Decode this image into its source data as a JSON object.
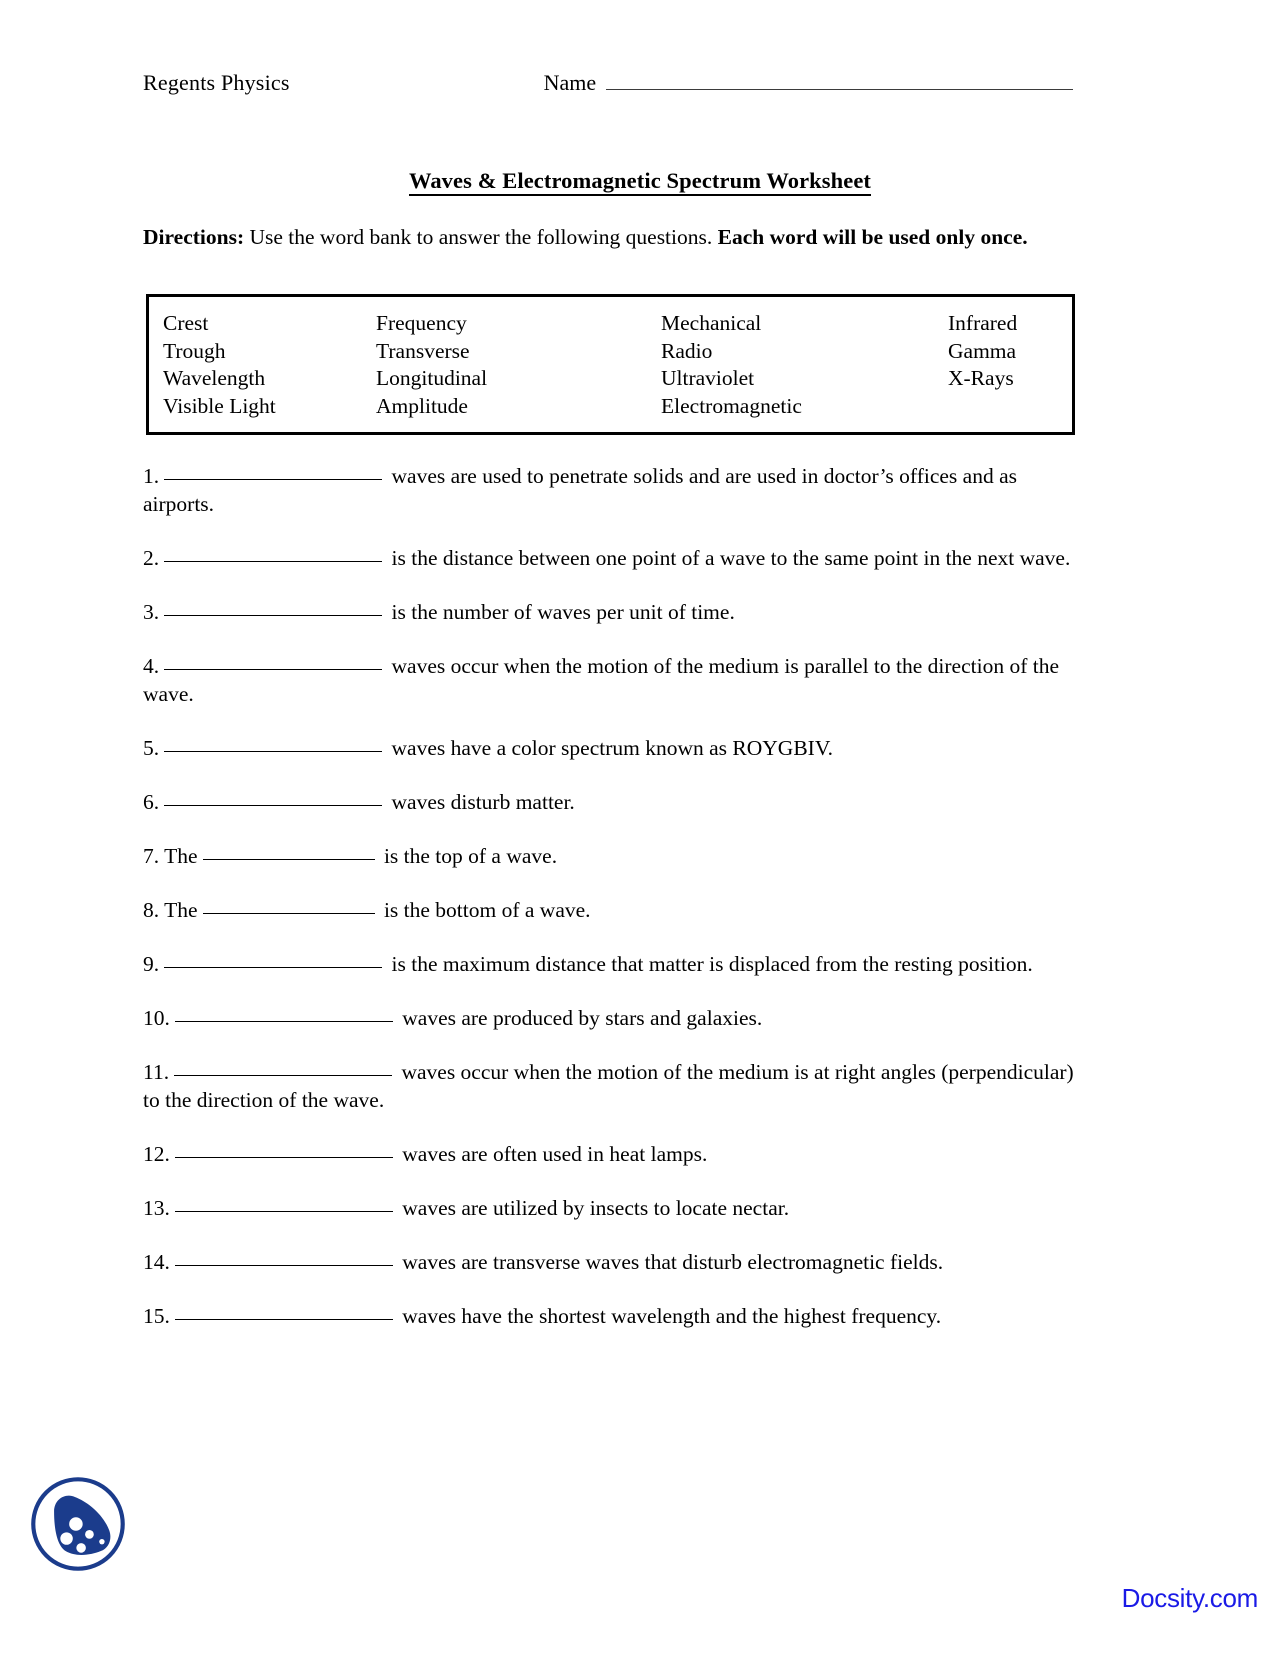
{
  "header": {
    "course": "Regents Physics",
    "name_label": "Name",
    "name_value": ""
  },
  "title": "Waves & Electromagnetic Spectrum Worksheet",
  "directions": {
    "label": "Directions:",
    "body": " Use the word bank to answer the following questions. ",
    "emphasis": "Each word will be used only once."
  },
  "word_bank": {
    "columns": [
      [
        "Crest",
        "Trough",
        "Wavelength",
        "Visible Light"
      ],
      [
        "Frequency",
        "Transverse",
        "Longitudinal",
        "Amplitude"
      ],
      [
        "Mechanical",
        "Radio",
        "Ultraviolet",
        "Electromagnetic"
      ],
      [
        "Infrared",
        "Gamma",
        "X-Rays"
      ]
    ]
  },
  "questions": [
    {
      "number": "1.",
      "pre": "",
      "blank": "long",
      "post": " waves are used to penetrate solids and are used in doctor’s offices and as airports."
    },
    {
      "number": "2.",
      "pre": "",
      "blank": "long",
      "post": " is the distance between one point of a wave to the same point in the next wave."
    },
    {
      "number": "3.",
      "pre": "",
      "blank": "long",
      "post": " is the number of waves per unit of time."
    },
    {
      "number": "4.",
      "pre": "",
      "blank": "long",
      "post": " waves occur when the motion of the medium is parallel to the direction of the wave."
    },
    {
      "number": "5.",
      "pre": "",
      "blank": "long",
      "post": " waves have a color spectrum known as ROYGBIV."
    },
    {
      "number": "6.",
      "pre": "",
      "blank": "long",
      "post": " waves disturb matter."
    },
    {
      "number": "7.",
      "pre": "The",
      "blank": "short",
      "post": " is the top of a wave."
    },
    {
      "number": "8.",
      "pre": "The",
      "blank": "short",
      "post": " is the bottom of a wave."
    },
    {
      "number": "9.",
      "pre": "",
      "blank": "long",
      "post": " is the maximum distance that matter is displaced from the resting position."
    },
    {
      "number": "10.",
      "pre": "",
      "blank": "long",
      "post": " waves are produced by stars and galaxies."
    },
    {
      "number": "11.",
      "pre": "",
      "blank": "long",
      "post": " waves occur when the motion of the medium is at right angles (perpendicular) to the direction of the wave."
    },
    {
      "number": "12.",
      "pre": "",
      "blank": "long",
      "post": " waves are often used in heat lamps."
    },
    {
      "number": "13.",
      "pre": "",
      "blank": "long",
      "post": " waves are utilized by insects to locate nectar."
    },
    {
      "number": "14.",
      "pre": "",
      "blank": "long",
      "post": " waves are transverse waves that disturb electromagnetic fields."
    },
    {
      "number": "15.",
      "pre": "",
      "blank": "long",
      "post": " waves have the shortest wavelength and the highest frequency."
    }
  ],
  "footer": {
    "watermark_text": "Docsity.com",
    "watermark_color": "#1A1AE6",
    "logo_color": "#1B3C8C",
    "logo_name": "docsity-cookie-logo"
  }
}
